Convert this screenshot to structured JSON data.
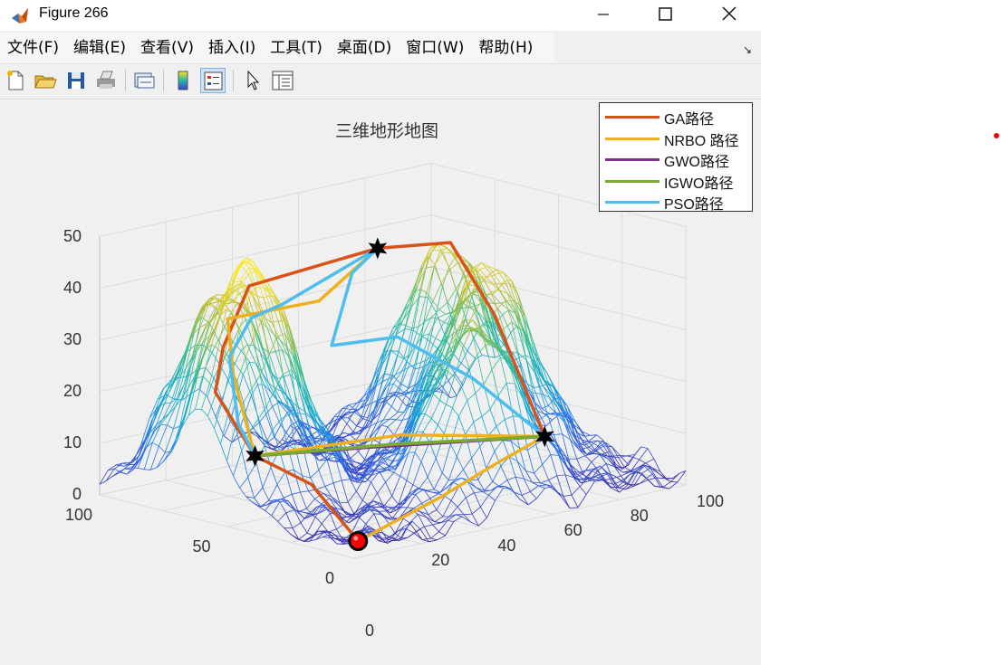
{
  "window": {
    "title": "Figure 266",
    "icon": "matlab-icon"
  },
  "menu": [
    "文件(F)",
    "编辑(E)",
    "查看(V)",
    "插入(I)",
    "工具(T)",
    "桌面(D)",
    "窗口(W)",
    "帮助(H)"
  ],
  "toolbar": [
    "new-figure-icon",
    "open-icon",
    "save-icon",
    "print-icon",
    "link-plot-icon",
    "colorbar-icon",
    "legend-icon",
    "pointer-icon",
    "property-inspector-icon"
  ],
  "chart_data": {
    "type": "surface-mesh-3d",
    "title": "三维地形地图",
    "xlim": [
      0,
      100
    ],
    "ylim": [
      0,
      100
    ],
    "zlim": [
      0,
      50
    ],
    "x_ticks": [
      0,
      20,
      40,
      60,
      80,
      100
    ],
    "y_ticks": [
      0,
      50,
      100
    ],
    "z_ticks": [
      0,
      10,
      20,
      30,
      40,
      50
    ],
    "grid": true,
    "legend_position": "top-right",
    "colormap": "parula",
    "terrain_peaks": [
      {
        "x": 15,
        "y": 60,
        "h": 45
      },
      {
        "x": 25,
        "y": 85,
        "h": 34
      },
      {
        "x": 55,
        "y": 25,
        "h": 30
      },
      {
        "x": 75,
        "y": 45,
        "h": 38
      },
      {
        "x": 85,
        "y": 75,
        "h": 37
      }
    ],
    "start_point": {
      "x": 5,
      "y": 5,
      "z": 2
    },
    "waypoints": [
      {
        "x": 20,
        "y": 65,
        "z": 9
      },
      {
        "x": 92,
        "y": 45,
        "z": 5
      },
      {
        "x": 80,
        "y": 95,
        "z": 37
      }
    ],
    "series": [
      {
        "name": "GA路径",
        "color": "#d95319",
        "points": [
          [
            5,
            5,
            2
          ],
          [
            14,
            35,
            8
          ],
          [
            20,
            65,
            9
          ],
          [
            18,
            78,
            20
          ],
          [
            28,
            88,
            26
          ],
          [
            42,
            96,
            35
          ],
          [
            80,
            95,
            37
          ],
          [
            92,
            82,
            38
          ],
          [
            96,
            70,
            25
          ],
          [
            92,
            45,
            5
          ]
        ]
      },
      {
        "name": "NRBO 路径",
        "color": "#edb120",
        "points": [
          [
            5,
            5,
            2
          ],
          [
            40,
            18,
            4
          ],
          [
            68,
            32,
            5
          ],
          [
            92,
            45,
            5
          ],
          [
            60,
            60,
            8
          ],
          [
            20,
            65,
            9
          ],
          [
            25,
            80,
            22
          ],
          [
            34,
            94,
            30
          ],
          [
            60,
            92,
            30
          ],
          [
            80,
            95,
            37
          ]
        ]
      },
      {
        "name": "GWO路径",
        "color": "#7e2f8e",
        "points": [
          [
            20,
            65,
            9
          ],
          [
            50,
            60,
            7
          ],
          [
            92,
            45,
            5
          ]
        ]
      },
      {
        "name": "IGWO路径",
        "color": "#77ac30",
        "points": [
          [
            20,
            65,
            9
          ],
          [
            56,
            58,
            7
          ],
          [
            92,
            45,
            5
          ]
        ]
      },
      {
        "name": "PSO路径",
        "color": "#4dbeee",
        "points": [
          [
            92,
            45,
            5
          ],
          [
            88,
            68,
            14
          ],
          [
            76,
            82,
            22
          ],
          [
            60,
            87,
            22
          ],
          [
            70,
            92,
            34
          ],
          [
            80,
            95,
            37
          ],
          [
            52,
            96,
            30
          ],
          [
            45,
            99,
            28
          ],
          [
            36,
            96,
            22
          ],
          [
            28,
            82,
            12
          ],
          [
            20,
            65,
            9
          ]
        ]
      }
    ]
  },
  "colors": {
    "start_marker": "#ff0000",
    "waypoint_marker": "#000000"
  }
}
